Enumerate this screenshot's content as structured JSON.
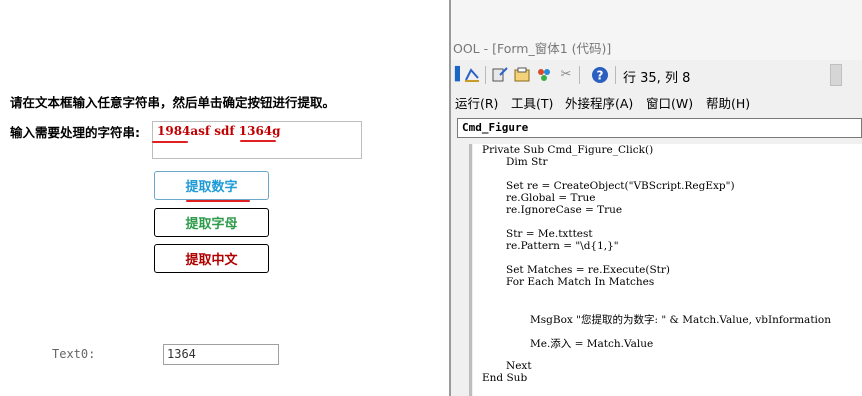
{
  "form": {
    "instruction": "请在文本框输入任意字符串，然后单击确定按钮进行提取。",
    "input_label": "输入需要处理的字符串:",
    "input_value": "1984asf sdf 1364g",
    "buttons": {
      "extract_numbers": "提取数字",
      "extract_letters": "提取字母",
      "extract_chinese": "提取中文"
    },
    "text0_label": "Text0:",
    "text0_value": "1364"
  },
  "editor": {
    "title": "OOL - [Form_窗体1 (代码)]",
    "cursor_position": "行 35, 列 8",
    "menu": [
      "运行(R)",
      "工具(T)",
      "外接程序(A)",
      "窗口(W)",
      "帮助(H)"
    ],
    "object_combo": "Cmd_Figure",
    "code_lines": [
      "Private Sub Cmd_Figure_Click()",
      "Dim Str",
      "Set re = CreateObject(\"VBScript.RegExp\")",
      "re.Global = True",
      "re.IgnoreCase = True",
      "Str = Me.txttest",
      "re.Pattern = \"\\d{1,}\"",
      "Set Matches = re.Execute(Str)",
      "For Each Match In Matches",
      "MsgBox \"您提取的为数字: \" & Match.Value, vbInformation",
      "Me.添入 = Match.Value",
      "Next",
      "End Sub"
    ]
  },
  "colors": {
    "input_text": "#c00000",
    "annotation_underline": "#e02020",
    "btn_numbers": "#1e9bd7",
    "btn_letters": "#2e9b4a",
    "btn_chinese": "#b00000"
  },
  "icons": [
    "view-access-icon",
    "insert-module-icon",
    "project-explorer-icon",
    "properties-icon",
    "object-browser-icon",
    "toolbox-icon",
    "help-icon"
  ]
}
